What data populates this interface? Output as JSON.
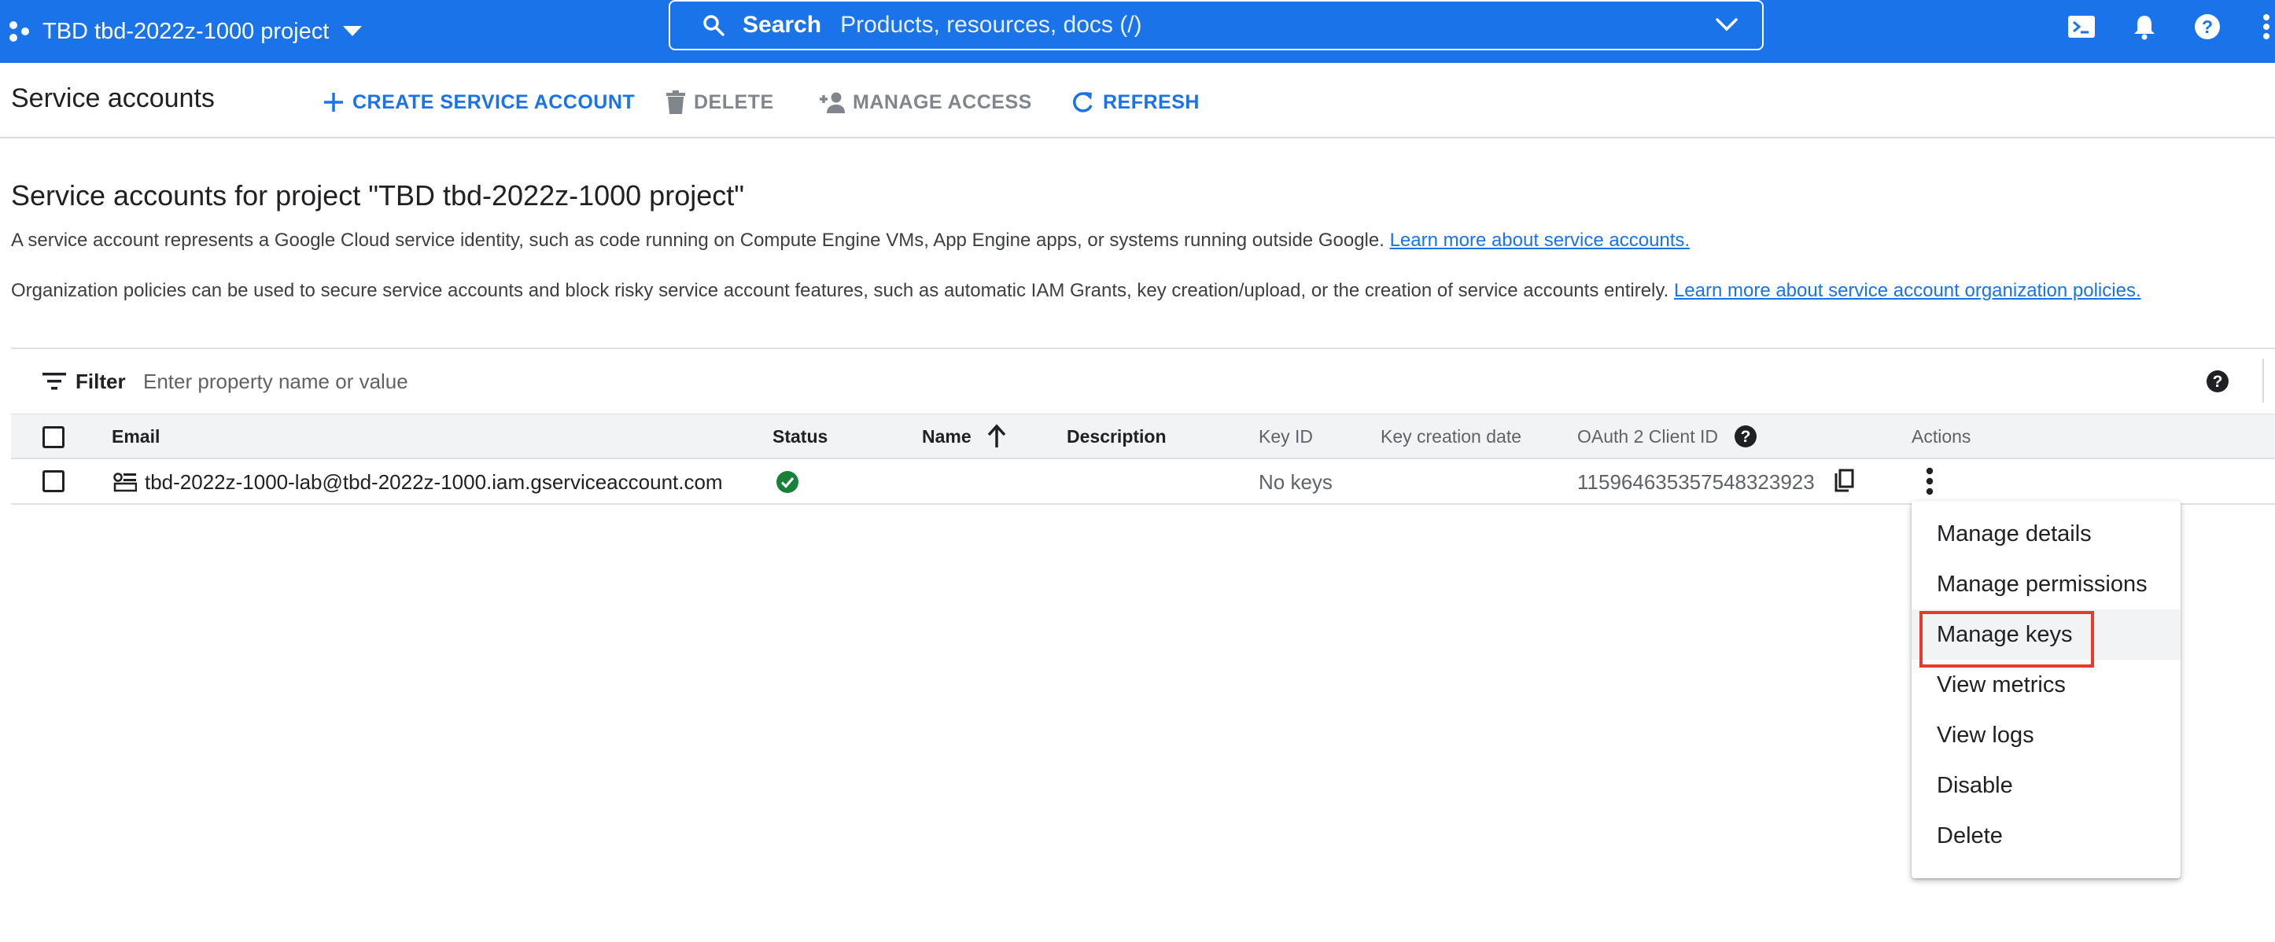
{
  "topbar": {
    "project_name": "TBD tbd-2022z-1000 project",
    "search_label": "Search",
    "search_placeholder": "Products, resources, docs (/)",
    "brand_color": "#1a73e8"
  },
  "toolbar": {
    "title": "Service accounts",
    "create_label": "CREATE SERVICE ACCOUNT",
    "delete_label": "DELETE",
    "manage_access_label": "MANAGE ACCESS",
    "refresh_label": "REFRESH"
  },
  "content": {
    "heading": "Service accounts for project \"TBD tbd-2022z-1000 project\"",
    "desc1_text": "A service account represents a Google Cloud service identity, such as code running on Compute Engine VMs, App Engine apps, or systems running outside Google.",
    "desc1_link": "Learn more about service accounts.",
    "desc2_text": "Organization policies can be used to secure service accounts and block risky service account features, such as automatic IAM Grants, key creation/upload, or the creation of service accounts entirely.",
    "desc2_link": "Learn more about service account organization policies."
  },
  "filter": {
    "label": "Filter",
    "placeholder": "Enter property name or value"
  },
  "table": {
    "columns": {
      "email": "Email",
      "status": "Status",
      "name": "Name",
      "description": "Description",
      "key_id": "Key ID",
      "key_creation_date": "Key creation date",
      "oauth_client_id": "OAuth 2 Client ID",
      "actions": "Actions"
    },
    "rows": [
      {
        "email": "tbd-2022z-1000-lab@tbd-2022z-1000.iam.gserviceaccount.com",
        "status": "enabled",
        "status_color": "#188038",
        "name": "",
        "description": "",
        "key_id": "No keys",
        "key_creation_date": "",
        "oauth_client_id": "115964635357548323923"
      }
    ]
  },
  "actions_menu": {
    "items": [
      "Manage details",
      "Manage permissions",
      "Manage keys",
      "View metrics",
      "View logs",
      "Disable",
      "Delete"
    ],
    "highlighted_item": "Manage keys",
    "highlight_color": "#e53c2e"
  }
}
